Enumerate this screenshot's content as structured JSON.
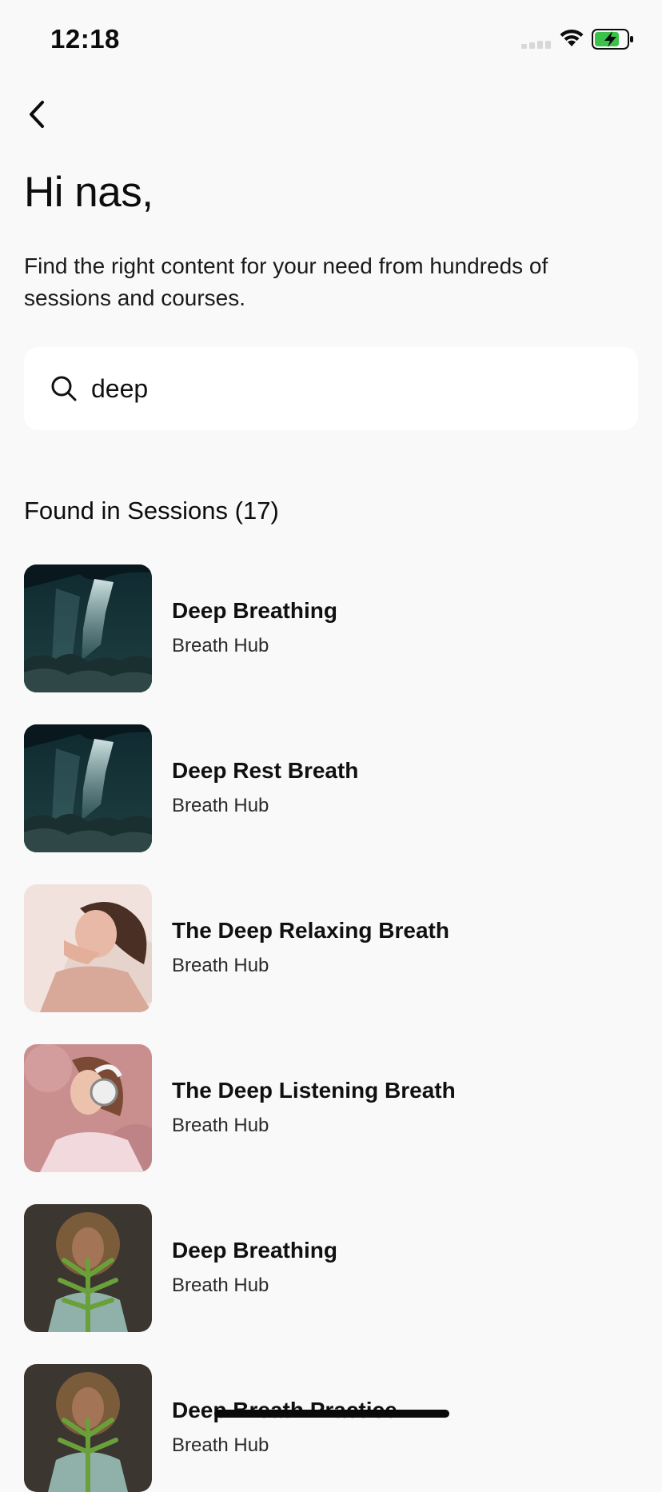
{
  "status_bar": {
    "time": "12:18",
    "icons": [
      "cellular-signal-icon",
      "wifi-icon",
      "battery-charging-icon"
    ],
    "battery_color": "#3cc24a"
  },
  "header": {
    "back_icon": "chevron-left-icon",
    "greeting": "Hi nas,",
    "subtitle": "Find the right content for your need from hundreds of sessions and courses."
  },
  "search": {
    "icon": "search-icon",
    "value": "deep"
  },
  "results": {
    "section_title": "Found in Sessions (17)",
    "items": [
      {
        "title": "Deep Breathing",
        "subtitle": "Breath Hub",
        "thumb": "cave-light"
      },
      {
        "title": "Deep Rest Breath",
        "subtitle": "Breath Hub",
        "thumb": "cave-light"
      },
      {
        "title": "The Deep Relaxing Breath",
        "subtitle": "Breath Hub",
        "thumb": "woman-resting"
      },
      {
        "title": "The Deep Listening Breath",
        "subtitle": "Breath Hub",
        "thumb": "woman-headphones"
      },
      {
        "title": "Deep Breathing",
        "subtitle": "Breath Hub",
        "thumb": "woman-fern"
      },
      {
        "title": "Deep Breath Practice",
        "subtitle": "Breath Hub",
        "thumb": "woman-fern"
      }
    ]
  },
  "colors": {
    "background": "#f9f9f9",
    "search_background": "#ffffff",
    "text_primary": "#101010"
  }
}
